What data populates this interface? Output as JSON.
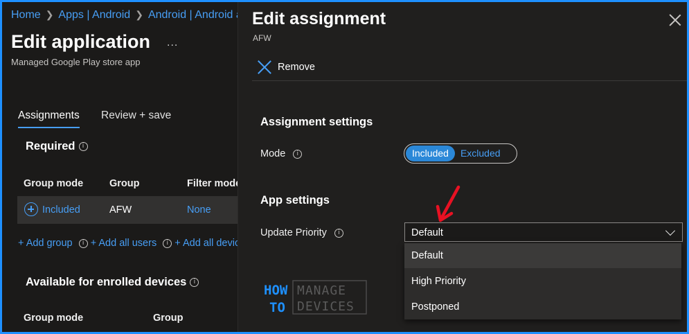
{
  "breadcrumb": [
    "Home",
    "Apps | Android",
    "Android | Android apps"
  ],
  "page": {
    "title": "Edit application",
    "more": "...",
    "subtitle": "Managed Google Play store app"
  },
  "tabs": [
    {
      "label": "Assignments",
      "active": true
    },
    {
      "label": "Review + save",
      "active": false
    }
  ],
  "required": {
    "title": "Required",
    "columns": [
      "Group mode",
      "Group",
      "Filter mode"
    ],
    "row": {
      "mode": "Included",
      "group": "AFW",
      "filter": "None"
    },
    "links": [
      "+ Add group",
      "+ Add all users",
      "+ Add all devices"
    ]
  },
  "available": {
    "title": "Available for enrolled devices",
    "columns": [
      "Group mode",
      "Group"
    ]
  },
  "panel": {
    "title": "Edit assignment",
    "subtitle": "AFW",
    "remove": "Remove",
    "assignment_settings": "Assignment settings",
    "mode_label": "Mode",
    "mode_options": [
      "Included",
      "Excluded"
    ],
    "mode_selected": "Included",
    "app_settings": "App settings",
    "priority_label": "Update Priority",
    "priority_value": "Default",
    "priority_options": [
      "Default",
      "High Priority",
      "Postponed"
    ]
  },
  "logo": {
    "line1": "HOW",
    "line2": "TO",
    "word1": "MANAGE",
    "word2": "DEVICES"
  },
  "colors": {
    "accent": "#479ef5",
    "toggle_on": "#2b88d8",
    "arrow": "#e81123",
    "frame": "#1e90ff"
  }
}
